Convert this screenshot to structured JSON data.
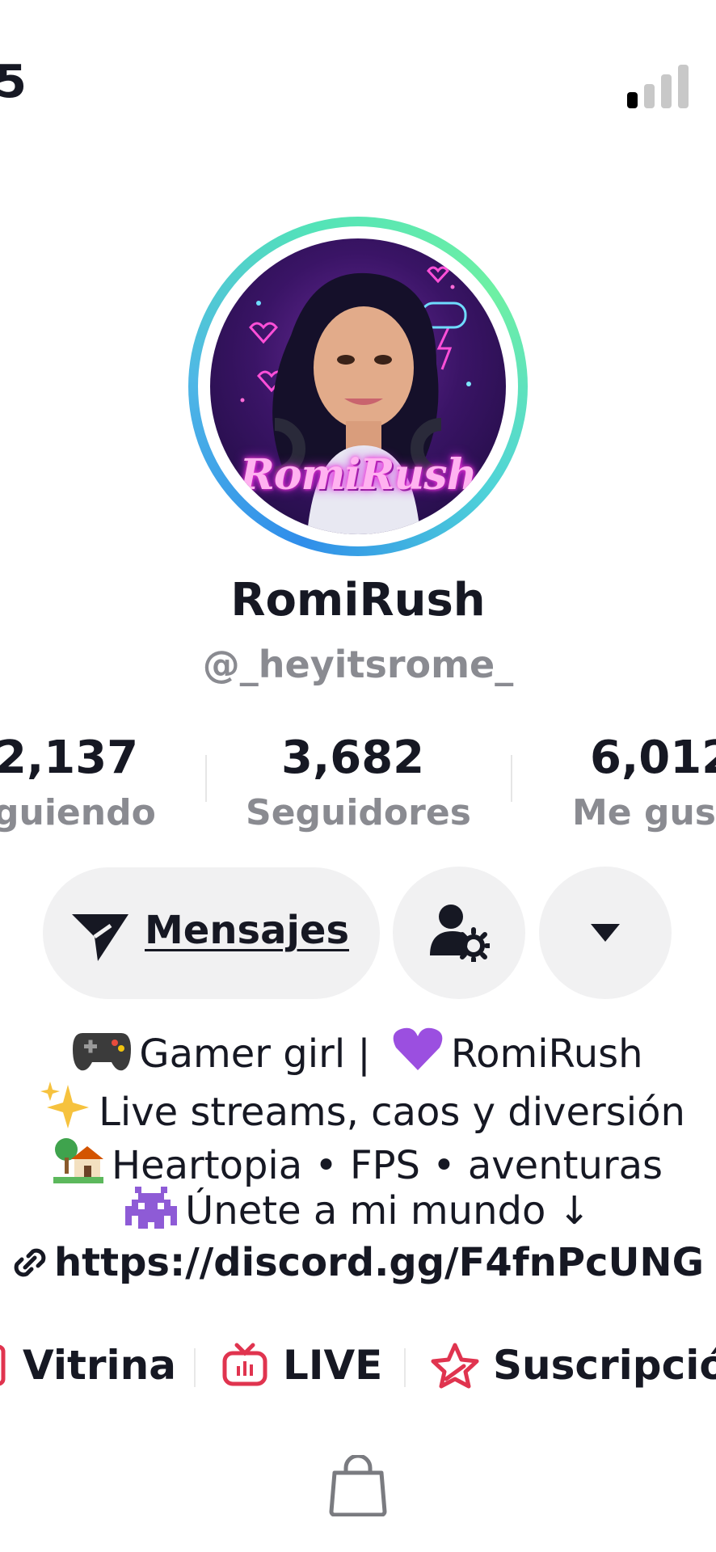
{
  "status_bar": {
    "time": "5",
    "signal_bars": 1
  },
  "profile": {
    "avatar_caption": "RomiRush",
    "display_name": "RomiRush",
    "username": "@_heyitsrome_"
  },
  "stats": [
    {
      "value": "2,137",
      "label": "guiendo"
    },
    {
      "value": "3,682",
      "label": "Seguidores"
    },
    {
      "value": "6,012",
      "label": "Me gus"
    }
  ],
  "actions": {
    "messages_label": "Mensajes",
    "messages_icon": "send-icon",
    "friend_icon": "user-settings-icon",
    "more_icon": "caret-down-icon"
  },
  "bio": {
    "line1": {
      "emoji_icon": "game-controller-icon",
      "text_a": "Gamer girl |",
      "emoji2_icon": "purple-heart-icon",
      "text_b": "RomiRush"
    },
    "line2": {
      "emoji_icon": "sparkles-icon",
      "text": "Live streams, caos y diversión"
    },
    "line3": {
      "emoji_icon": "house-with-garden-icon",
      "text": "Heartopia • FPS • aventuras"
    },
    "line4": {
      "emoji_icon": "alien-monster-icon",
      "text": "Únete a mi mundo ↓"
    },
    "link": {
      "icon": "link-icon",
      "text": "https://discord.gg/F4fnPcUNG"
    }
  },
  "features": [
    {
      "label": "Vitrina",
      "icon": "showcase-icon"
    },
    {
      "label": "LIVE",
      "icon": "live-tv-icon"
    },
    {
      "label": "Suscripció",
      "icon": "subscription-star-icon"
    }
  ],
  "tabs": {
    "shop_icon": "shopping-bag-icon"
  },
  "colors": {
    "accent_red": "#e0344f",
    "text_primary": "#161823",
    "text_secondary": "#8a8b91",
    "button_bg": "#f1f1f2",
    "ring_start": "#2f8dea",
    "ring_end": "#6ef0a4"
  }
}
